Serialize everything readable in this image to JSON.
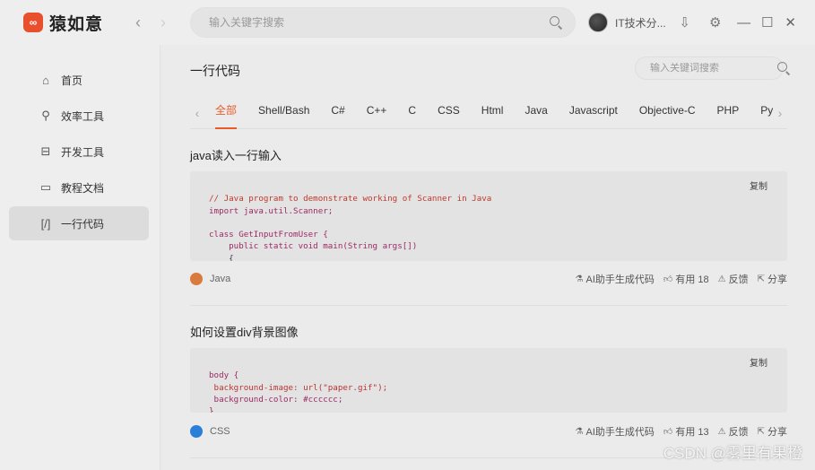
{
  "app": {
    "name": "猿如意",
    "logo_glyph": "∞"
  },
  "titlebar": {
    "search_placeholder": "输入关键字搜索",
    "username": "IT技术分...",
    "download_glyph": "⇩",
    "settings_glyph": "⚙",
    "minimize_glyph": "—",
    "maximize_glyph": "☐",
    "close_glyph": "✕"
  },
  "sidebar": {
    "items": [
      {
        "label": "首页",
        "glyph": "⌂"
      },
      {
        "label": "效率工具",
        "glyph": "⚲"
      },
      {
        "label": "开发工具",
        "glyph": "⊟"
      },
      {
        "label": "教程文档",
        "glyph": "▭"
      },
      {
        "label": "一行代码",
        "glyph": "[/]"
      }
    ],
    "active_index": 4
  },
  "main": {
    "title": "一行代码",
    "search_placeholder": "输入关键词搜索",
    "tabs": [
      "全部",
      "Shell/Bash",
      "C#",
      "C++",
      "C",
      "CSS",
      "Html",
      "Java",
      "Javascript",
      "Objective-C",
      "PHP",
      "Py"
    ],
    "active_tab": 0
  },
  "cards": [
    {
      "title": "java读入一行输入",
      "copy_label": "复制",
      "code": [
        "// Java program to demonstrate working of Scanner in Java",
        "import java.util.Scanner;",
        "",
        "class GetInputFromUser {",
        "    public static void main(String args[])",
        "    {"
      ],
      "lang": "Java",
      "lang_color": "#d97b3c",
      "ai_label": "AI助手生成代码",
      "useful_label": "有用 18",
      "feedback_label": "反馈",
      "share_label": "分享"
    },
    {
      "title": "如何设置div背景图像",
      "copy_label": "复制",
      "code": [
        "body {",
        " background-image: url(\"paper.gif\");",
        " background-color: #cccccc;",
        "}"
      ],
      "lang": "CSS",
      "lang_color": "#2b7fd8",
      "ai_label": "AI助手生成代码",
      "useful_label": "有用 13",
      "feedback_label": "反馈",
      "share_label": "分享"
    }
  ],
  "watermark": "CSDN @雾里有果橙",
  "colors": {
    "accent": "#e85c2c",
    "logo": "#ea4f2d"
  }
}
